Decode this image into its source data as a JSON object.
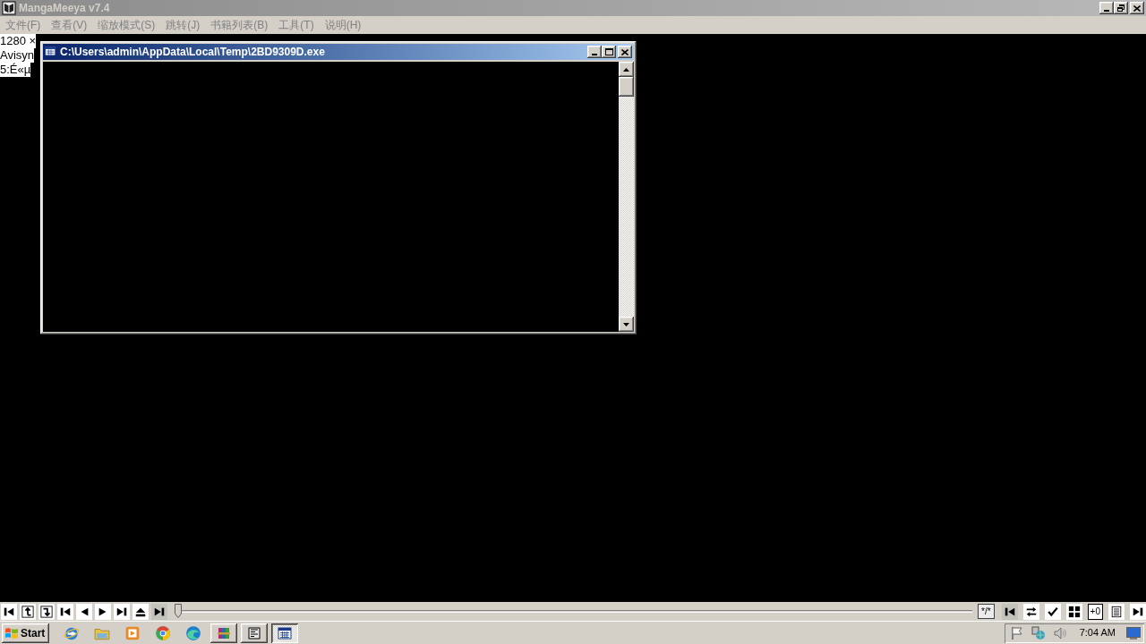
{
  "window": {
    "title": "MangaMeeya v7.4",
    "active": false
  },
  "menu": [
    "文件(F)",
    "查看(V)",
    "缩放模式(S)",
    "跳转(J)",
    "书籍列表(B)",
    "工具(T)",
    "说明(H)"
  ],
  "background_text": [
    "1280 ×",
    "Avisyn",
    "5:É«µ"
  ],
  "console": {
    "title": "C:\\Users\\admin\\AppData\\Local\\Temp\\2BD9309D.exe",
    "active": true
  },
  "toolbar": {
    "left_buttons": [
      {
        "kind": "first",
        "disabled": false
      },
      {
        "kind": "back",
        "disabled": false
      },
      {
        "kind": "forward",
        "disabled": false
      },
      {
        "kind": "skip_back",
        "disabled": false
      },
      {
        "kind": "prev",
        "disabled": false
      },
      {
        "kind": "play",
        "disabled": false
      },
      {
        "kind": "skip_next",
        "disabled": false
      },
      {
        "kind": "eject",
        "disabled": false
      },
      {
        "kind": "last",
        "disabled": true
      }
    ],
    "slider": {
      "level": 0
    },
    "page_counter": "*/*",
    "right_buttons": [
      {
        "kind": "skip_back",
        "disabled": true
      },
      {
        "kind": "swap",
        "disabled": false
      },
      {
        "kind": "check",
        "disabled": false
      },
      {
        "kind": "grid",
        "disabled": false
      },
      {
        "kind": "offset",
        "label": "+0",
        "disabled": false
      },
      {
        "kind": "list",
        "disabled": false
      },
      {
        "kind": "last",
        "disabled": false
      }
    ]
  },
  "taskbar": {
    "start": "Start",
    "quick_launch": [
      {
        "kind": "e_logo"
      },
      {
        "kind": "folder"
      },
      {
        "kind": "player"
      },
      {
        "kind": "ball"
      },
      {
        "kind": "wave"
      }
    ],
    "tasks": [
      {
        "kind": "books",
        "selected": false
      },
      {
        "kind": "reader",
        "selected": false
      },
      {
        "kind": "console",
        "selected": true
      }
    ],
    "clock": "7:04 AM"
  }
}
